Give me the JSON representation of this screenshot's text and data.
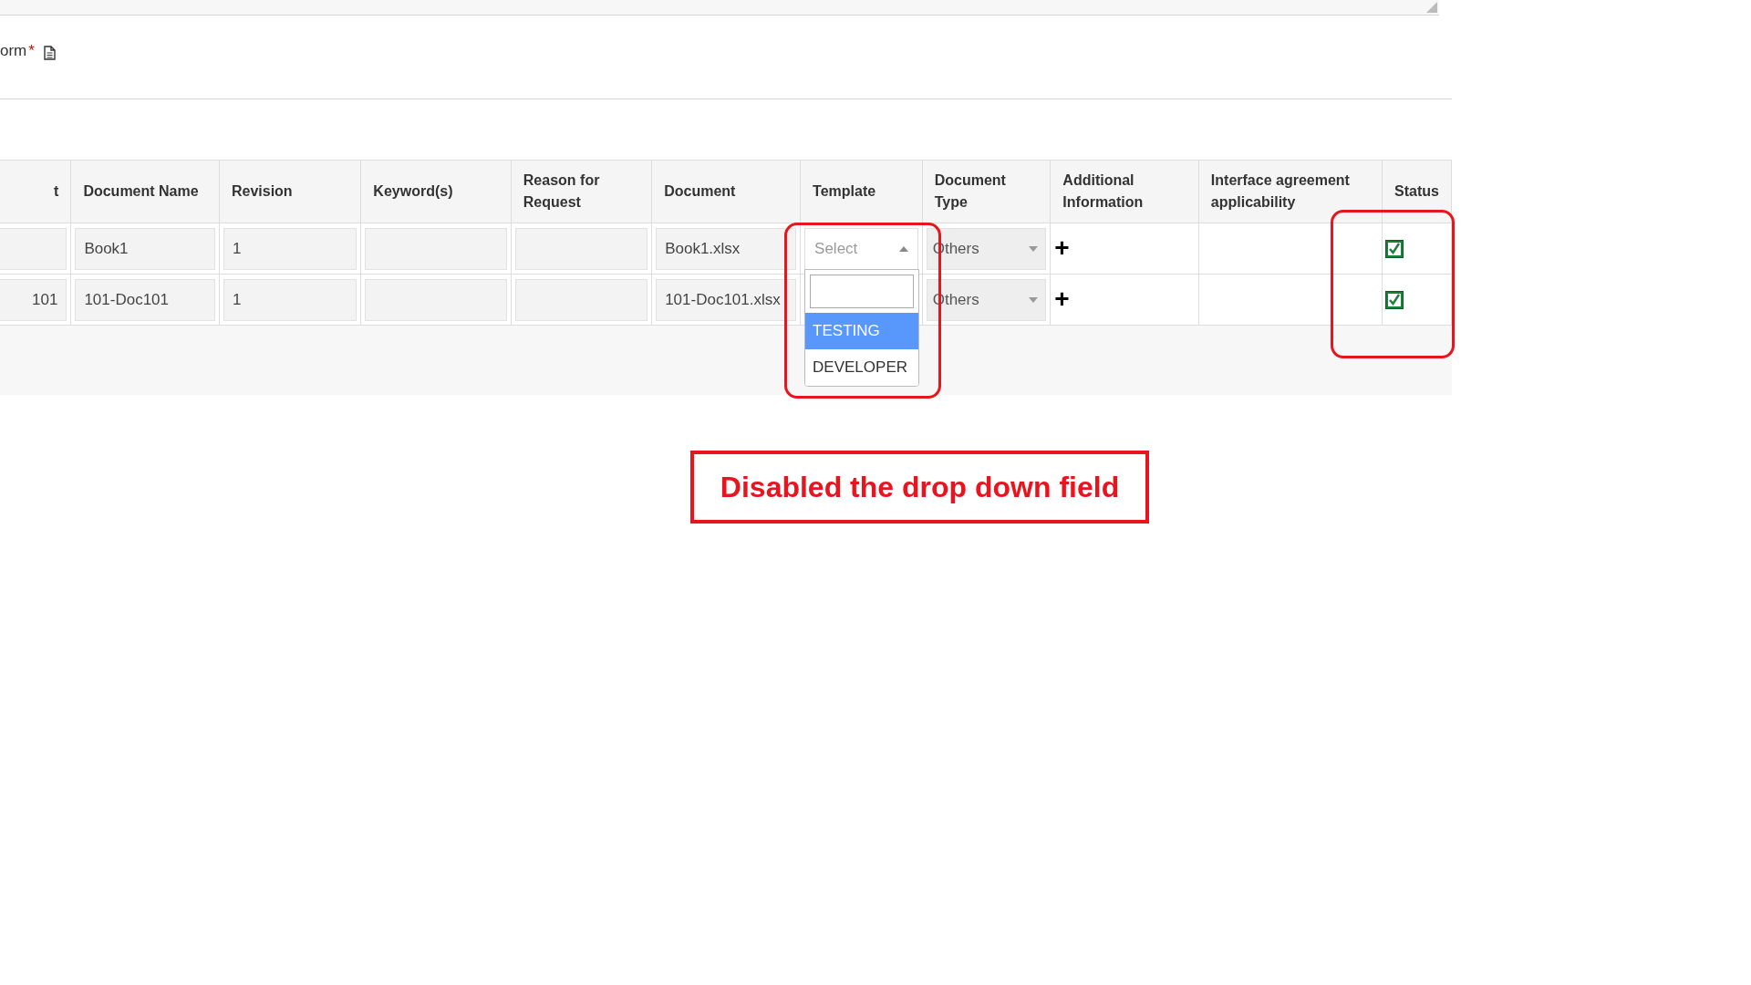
{
  "form_label": {
    "text": "orm",
    "required_mark": "*"
  },
  "table": {
    "columns": [
      "t",
      "Document Name",
      "Revision",
      "Keyword(s)",
      "Reason for Request",
      "Document",
      "Template",
      "Document Type",
      "Additional Information",
      "Interface agreement applicability",
      "Status"
    ],
    "rows": [
      {
        "document_name": "Book1",
        "revision": "1",
        "document": "Book1.xlsx",
        "template": {
          "placeholder": "Select",
          "expanded": true,
          "options": [
            {
              "label": "TESTING",
              "selected": true
            },
            {
              "label": "DEVELOPER",
              "selected": false
            }
          ]
        },
        "document_type": "Others",
        "add_button": "+",
        "status_checked": true
      },
      {
        "column_1": "101",
        "document_name": "101-Doc101",
        "revision": "1",
        "document": "101-Doc101.xlsx",
        "document_type": "Others",
        "add_button": "+",
        "status_checked": true
      }
    ]
  },
  "annotation": {
    "text": "Disabled the drop down field"
  }
}
